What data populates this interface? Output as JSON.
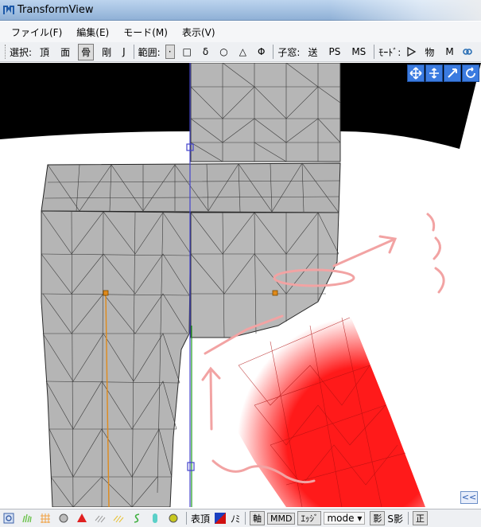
{
  "window": {
    "title": "TransformView"
  },
  "menu": {
    "items": [
      "ファイル(F)",
      "編集(E)",
      "モード(M)",
      "表示(V)"
    ]
  },
  "toolbar": {
    "select_label": "選択:",
    "select_items": [
      "頂",
      "面",
      "骨",
      "剛",
      "J"
    ],
    "active_select": "骨",
    "range_label": "範囲:",
    "range_items": [
      "·",
      "□",
      "δ",
      "○",
      "△",
      "Φ"
    ],
    "active_range": "·",
    "child_label": "子窓:",
    "child_items": [
      "送",
      "PS",
      "MS"
    ],
    "mode_label": "ﾓｰﾄﾞ:",
    "mode_items": [
      "物",
      "M"
    ]
  },
  "viewport": {
    "camera_tools": [
      "move-all-icon",
      "move-icon",
      "zoom-icon",
      "rotate-icon"
    ],
    "collapse_label": "<<",
    "annotation_colors": {
      "weight_red": "#ff1a1a",
      "handwriting": "#f2a3a3",
      "mesh_gray": "#b4b4b4"
    }
  },
  "statusbar": {
    "vertex_label": "表頂",
    "nomi_label": "ﾉﾐ",
    "axis_label": "軸",
    "mmd_label": "MMD",
    "edge_label": "ｴｯｼﾞ",
    "mode_select": "mode",
    "shadow_label": "影",
    "sshadow_label": "S影",
    "proper_label": "正"
  }
}
